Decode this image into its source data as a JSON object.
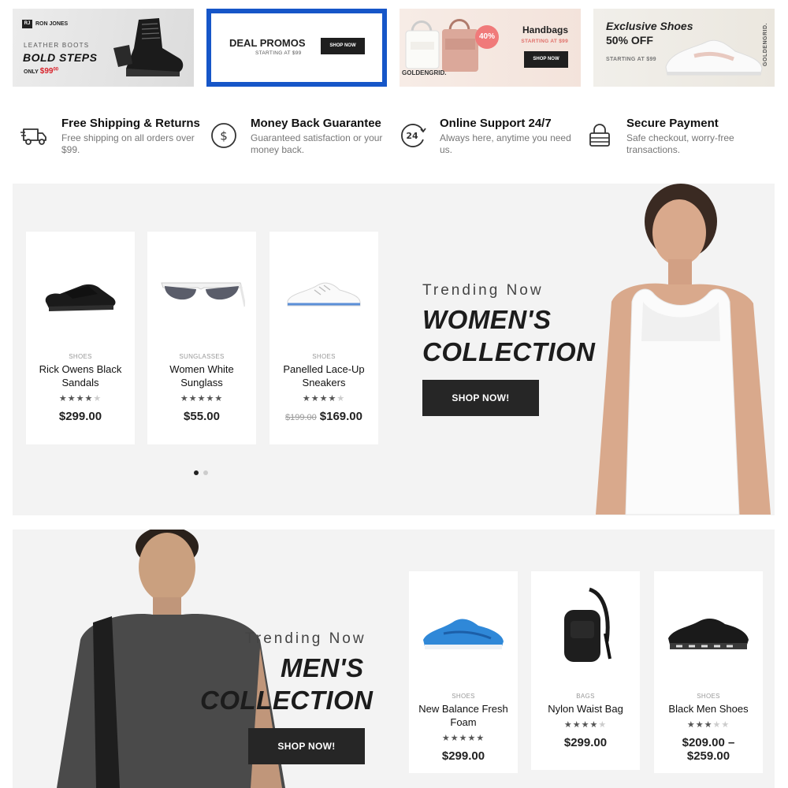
{
  "banners": {
    "leather": {
      "brand_mark": "RJ",
      "brand": "RON JONES",
      "subtitle": "LEATHER BOOTS",
      "title": "BOLD STEPS",
      "price_prefix": "ONLY",
      "price": "$99",
      "price_cents": "00"
    },
    "deals": {
      "title": "DEAL PROMOS",
      "subtitle": "STARTING AT $99",
      "button": "SHOP NOW"
    },
    "handbags": {
      "badge": "40%",
      "title": "Handbags",
      "subtitle": "STARTING AT $99",
      "button": "SHOP NOW",
      "brand": "GOLDENGRID."
    },
    "shoes": {
      "title": "Exclusive Shoes",
      "discount": "50% OFF",
      "subtitle": "STARTING AT $99",
      "brand": "GOLDENGRID."
    }
  },
  "features": [
    {
      "title": "Free Shipping & Returns",
      "desc": "Free shipping on all orders over $99.",
      "icon": "truck-icon"
    },
    {
      "title": "Money Back Guarantee",
      "desc": "Guaranteed satisfaction or your money back.",
      "icon": "dollar-coin-icon"
    },
    {
      "title": "Online Support 24/7",
      "desc": "Always here, anytime you need us.",
      "icon": "support-24-icon"
    },
    {
      "title": "Secure Payment",
      "desc": "Safe checkout, worry-free transactions.",
      "icon": "lock-icon"
    }
  ],
  "womens": {
    "trend_label": "Trending Now",
    "collection_line1": "WOMEN'S",
    "collection_line2": "COLLECTION",
    "button": "SHOP NOW!",
    "carousel_page": 1,
    "carousel_pages": 2,
    "products": [
      {
        "category": "SHOES",
        "name": "Rick Owens Black Sandals",
        "rating": 4,
        "price": "$299.00",
        "old_price": ""
      },
      {
        "category": "SUNGLASSES",
        "name": "Women White Sunglass",
        "rating": 5,
        "price": "$55.00",
        "old_price": ""
      },
      {
        "category": "SHOES",
        "name": "Panelled Lace-Up Sneakers",
        "rating": 4,
        "price": "$169.00",
        "old_price": "$199.00"
      }
    ]
  },
  "mens": {
    "trend_label": "Trending Now",
    "collection_line1": "MEN'S",
    "collection_line2": "COLLECTION",
    "button": "SHOP NOW!",
    "products": [
      {
        "category": "SHOES",
        "name": "New Balance Fresh Foam",
        "rating": 5,
        "price": "$299.00",
        "old_price": ""
      },
      {
        "category": "BAGS",
        "name": "Nylon Waist Bag",
        "rating": 4,
        "price": "$299.00",
        "old_price": ""
      },
      {
        "category": "SHOES",
        "name": "Black Men Shoes",
        "rating": 3,
        "price": "$209.00 – $259.00",
        "old_price": ""
      }
    ]
  },
  "colors": {
    "accent_blue": "#1656c8",
    "button_dark": "#262626",
    "sale_red": "#d8222a",
    "section_bg": "#f3f3f3"
  }
}
